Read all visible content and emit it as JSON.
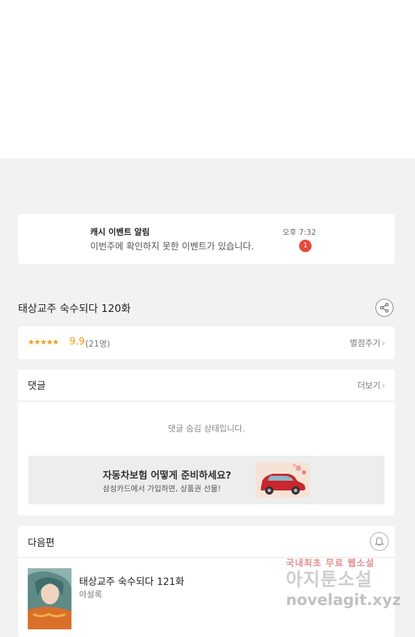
{
  "notification": {
    "title": "캐시 이벤트 알림",
    "message": "이번주에 확인하지 못한 이벤트가 있습니다.",
    "time": "오후 7:32",
    "badge_count": "1"
  },
  "episode": {
    "title": "태상교주 숙수되다 120화",
    "share_icon": "share-icon"
  },
  "rating": {
    "stars": "★★★★★",
    "score": "9.9",
    "count": "(21명)",
    "rate_label": "별점주기",
    "chevron": "›"
  },
  "comments": {
    "title": "댓글",
    "more_label": "더보기",
    "chevron": "›",
    "hidden_message": "댓글 숨김 상태입니다."
  },
  "ad": {
    "title": "자동차보험 어떻게 준비하세요?",
    "subtitle": "삼성카드에서 가입하면, 상품권 선물!"
  },
  "next_episode": {
    "section_title": "다음편",
    "title": "태상교주 숙수되다 121화",
    "author": "아설록",
    "bell_icon": "bell-icon"
  },
  "watermark": {
    "line1": "국내최초 무료 웹소설",
    "line2": "아지툰소설",
    "line3": "novelagit.xyz"
  },
  "colors": {
    "accent_orange": "#f39c12",
    "badge_red": "#e64b3c",
    "background": "#f2f2f2"
  }
}
